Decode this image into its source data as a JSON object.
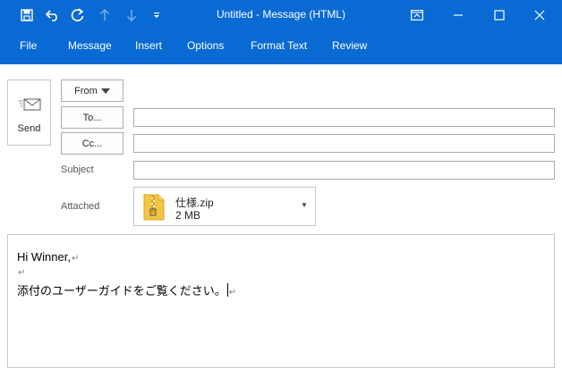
{
  "window": {
    "title": "Untitled  -  Message (HTML)"
  },
  "quick_access": {
    "icons": [
      "save-icon",
      "undo-icon",
      "redo-icon",
      "up-arrow-icon",
      "down-arrow-icon",
      "customize-icon"
    ]
  },
  "ribbon": {
    "tabs": [
      {
        "label": "File"
      },
      {
        "label": "Message"
      },
      {
        "label": "Insert"
      },
      {
        "label": "Options"
      },
      {
        "label": "Format Text"
      },
      {
        "label": "Review"
      }
    ]
  },
  "compose": {
    "send_label": "Send",
    "from_label": "From",
    "to_label": "To...",
    "cc_label": "Cc...",
    "subject_label": "Subject",
    "attached_label": "Attached",
    "to_value": "",
    "cc_value": "",
    "subject_value": "",
    "attachment": {
      "name": "仕様.zip",
      "size": "2 MB"
    },
    "body_lines": [
      "Hi Winner,",
      "",
      "添付のユーザーガイドをご覧ください。"
    ],
    "paragraph_mark": "↵"
  },
  "colors": {
    "titlebar": "#0a6ad3",
    "border": "#ababab"
  }
}
